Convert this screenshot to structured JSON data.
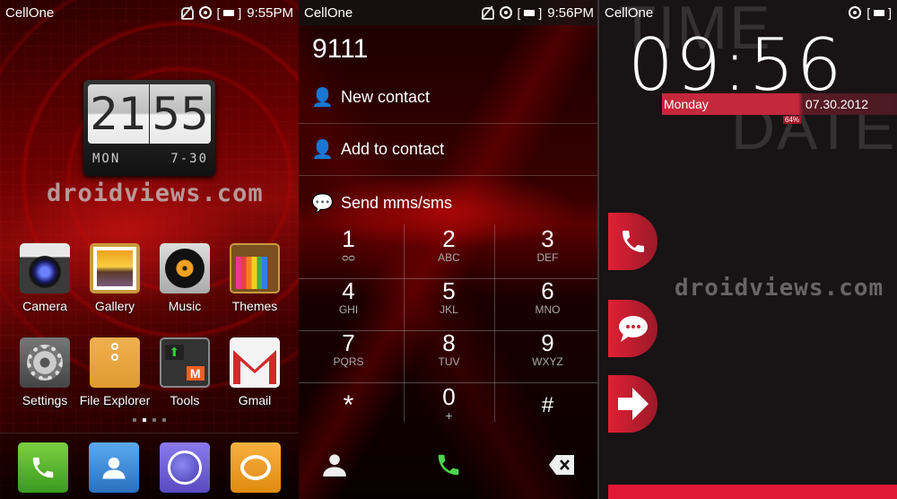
{
  "screens": [
    {
      "name": "home",
      "status": {
        "carrier": "CellOne",
        "time": "9:55PM"
      },
      "clock_widget": {
        "hour": "21",
        "minute": "55",
        "day": "MON",
        "date": "7-30"
      },
      "watermark": "droidviews.com",
      "apps": [
        {
          "label": "Camera",
          "icon": "camera-icon"
        },
        {
          "label": "Gallery",
          "icon": "gallery-icon"
        },
        {
          "label": "Music",
          "icon": "music-icon"
        },
        {
          "label": "Themes",
          "icon": "themes-icon"
        },
        {
          "label": "Settings",
          "icon": "settings-icon"
        },
        {
          "label": "File Explorer",
          "icon": "file-explorer-icon"
        },
        {
          "label": "Tools",
          "icon": "tools-folder-icon"
        },
        {
          "label": "Gmail",
          "icon": "gmail-icon"
        }
      ],
      "page_indicator": {
        "pages": 4,
        "current": 2
      },
      "dock": [
        "phone-icon",
        "contacts-icon",
        "browser-icon",
        "messaging-icon"
      ]
    },
    {
      "name": "dialer",
      "status": {
        "carrier": "CellOne",
        "time": "9:56PM"
      },
      "dialed_number": "9111",
      "actions": [
        {
          "label": "New contact",
          "icon": "add-contact-icon"
        },
        {
          "label": "Add to contact",
          "icon": "add-contact-icon"
        },
        {
          "label": "Send mms/sms",
          "icon": "message-icon"
        }
      ],
      "keys": [
        {
          "digit": "1",
          "letters": "ᴑᴑ"
        },
        {
          "digit": "2",
          "letters": "ABC"
        },
        {
          "digit": "3",
          "letters": "DEF"
        },
        {
          "digit": "4",
          "letters": "GHI"
        },
        {
          "digit": "5",
          "letters": "JKL"
        },
        {
          "digit": "6",
          "letters": "MNO"
        },
        {
          "digit": "7",
          "letters": "PQRS"
        },
        {
          "digit": "8",
          "letters": "TUV"
        },
        {
          "digit": "9",
          "letters": "WXYZ"
        },
        {
          "digit": "*",
          "letters": ""
        },
        {
          "digit": "0",
          "letters": "+"
        },
        {
          "digit": "#",
          "letters": ""
        }
      ]
    },
    {
      "name": "lockscreen",
      "status": {
        "carrier": "CellOne"
      },
      "bg_words": {
        "time": "TIME",
        "date": "DATE"
      },
      "time": "09:56",
      "day": "Monday",
      "date": "07.30.2012",
      "battery": "64%",
      "watermark": "droidviews.com",
      "shortcuts": [
        "phone-icon",
        "message-icon",
        "unlock-arrow-icon"
      ]
    }
  ],
  "colors": {
    "accent_red": "#e01836",
    "call_green": "#4cd44c"
  }
}
